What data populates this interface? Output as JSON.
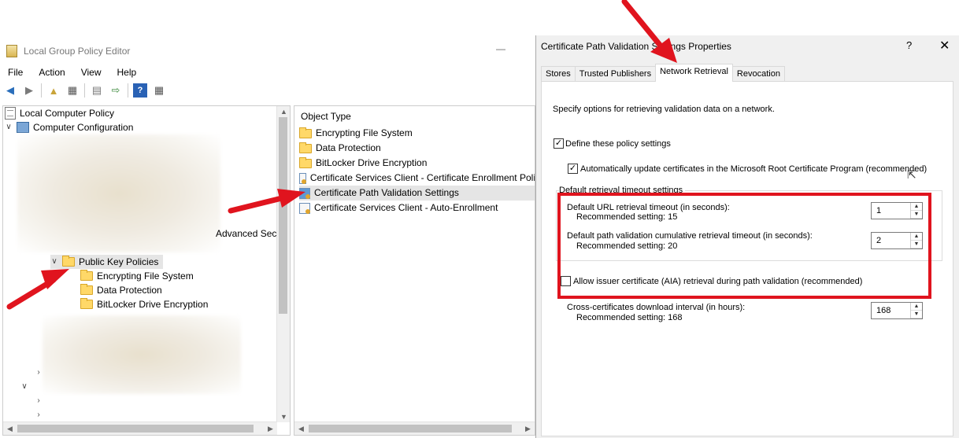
{
  "editor": {
    "title": "Local Group Policy Editor",
    "min_glyph": "—",
    "menu": [
      "File",
      "Action",
      "View",
      "Help"
    ],
    "tree": {
      "root": "Local Computer Policy",
      "computer_config": "Computer Configuration",
      "partial_item": "Advanced Secu",
      "public_key": "Public Key Policies",
      "children": [
        "Encrypting File System",
        "Data Protection",
        "BitLocker Drive Encryption"
      ]
    },
    "list": {
      "column": "Object Type",
      "items": [
        "Encrypting File System",
        "Data Protection",
        "BitLocker Drive Encryption",
        "Certificate Services Client - Certificate Enrollment Poli",
        "Certificate Path Validation Settings",
        "Certificate Services Client - Auto-Enrollment"
      ]
    }
  },
  "dialog": {
    "title": "Certificate Path Validation Settings Properties",
    "help": "?",
    "close": "✕",
    "tabs": [
      "Stores",
      "Trusted Publishers",
      "Network Retrieval",
      "Revocation"
    ],
    "active_tab": "Network Retrieval",
    "intro": "Specify options for retrieving validation data on a network.",
    "define_label": "Define these policy settings",
    "define_checked": true,
    "auto_update_label": "Automatically update certificates in the Microsoft Root Certificate Program (recommended)",
    "auto_update_checked": true,
    "group_label": "Default retrieval timeout settings",
    "url_timeout_label": "Default URL retrieval timeout (in seconds):",
    "url_timeout_rec": "Recommended setting: 15",
    "url_timeout_value": "1",
    "path_timeout_label": "Default path validation cumulative retrieval timeout (in seconds):",
    "path_timeout_rec": "Recommended setting: 20",
    "path_timeout_value": "2",
    "aia_label": "Allow issuer certificate (AIA) retrieval during path validation (recommended)",
    "aia_checked": false,
    "cross_label": "Cross-certificates download interval (in hours):",
    "cross_rec": "Recommended setting: 168",
    "cross_value": "168"
  },
  "colors": {
    "highlight_red": "#e0141e",
    "folder": "#ffd868"
  }
}
